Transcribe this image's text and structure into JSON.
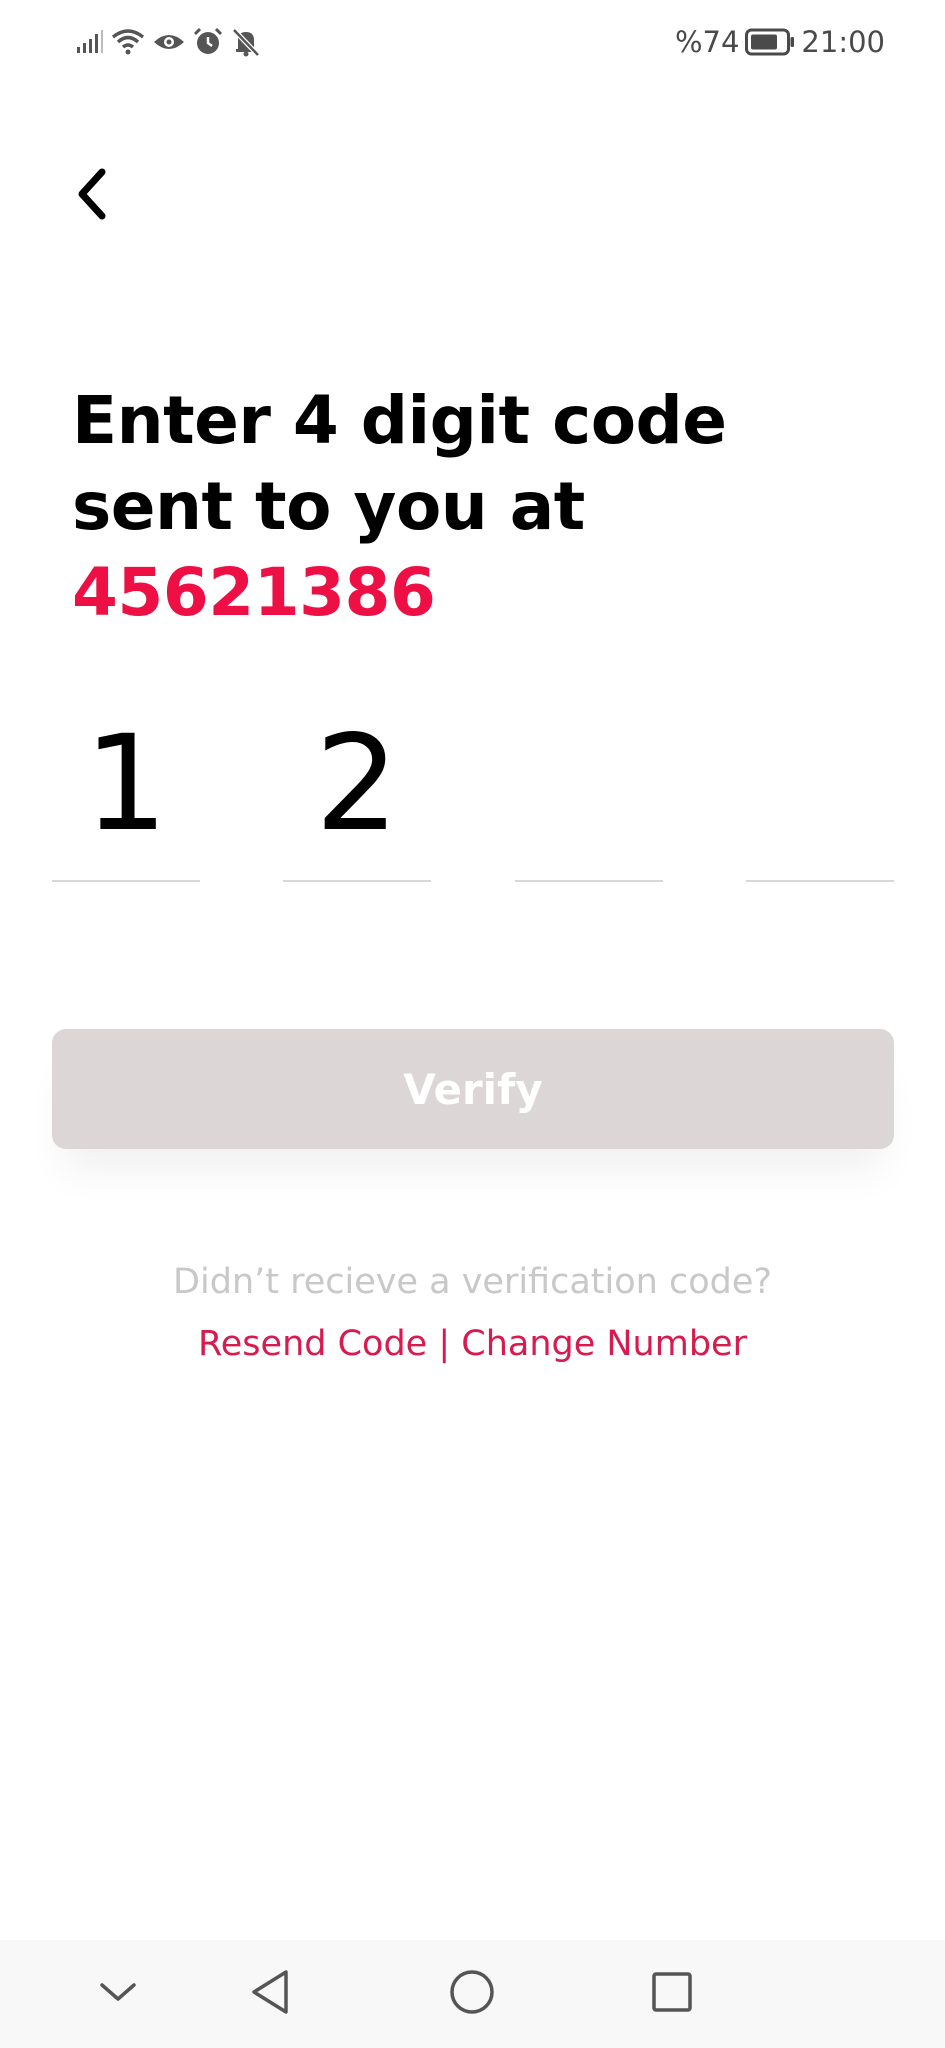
{
  "status_bar": {
    "battery_percent": "%74",
    "time": "21:00",
    "icons": [
      "signal-icon",
      "wifi-icon",
      "eye-icon",
      "alarm-icon",
      "mute-icon",
      "battery-icon"
    ]
  },
  "header": {
    "back_icon": "chevron-left-icon"
  },
  "title": {
    "text": "Enter 4 digit code sent to you at",
    "phone": "45621386",
    "phone_color": "#ee0f44"
  },
  "otp": {
    "digits": [
      "1",
      "2",
      "",
      ""
    ]
  },
  "verify": {
    "label": "Verify",
    "background": "#dcd6d6"
  },
  "resend": {
    "hint": "Didn’t recieve a verification code?",
    "resend_label": "Resend Code",
    "separator": " | ",
    "change_label": "Change Number",
    "link_color": "#d81b4f"
  },
  "nav_bar": {
    "icons": [
      "chevron-down-icon",
      "triangle-back-icon",
      "circle-home-icon",
      "square-recents-icon"
    ]
  }
}
